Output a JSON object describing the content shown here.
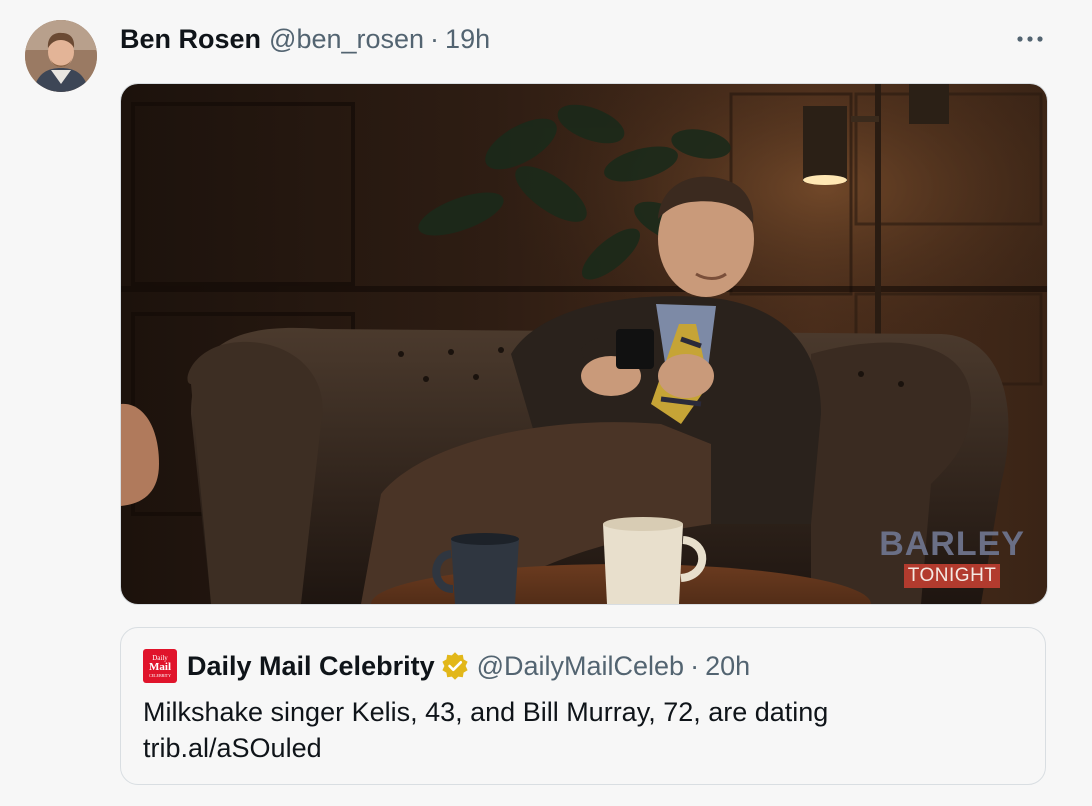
{
  "tweet": {
    "author_name": "Ben Rosen",
    "author_handle": "@ben_rosen",
    "separator": "·",
    "timestamp": "19h",
    "more_icon": "more-horizontal-icon",
    "media": {
      "watermark_top": "BARLEY",
      "watermark_bottom": "TONIGHT"
    }
  },
  "quote": {
    "logo_lines": [
      "Daily",
      "Mail",
      "CELEBRITY"
    ],
    "logo_color": "#e0142b",
    "author_name": "Daily Mail Celebrity",
    "verified_icon": "gold-verified-badge-icon",
    "verified_color": "#e2b719",
    "author_handle": "@DailyMailCeleb",
    "separator": "·",
    "timestamp": "20h",
    "text_line1": "Milkshake singer Kelis, 43, and Bill Murray, 72, are dating",
    "text_line2": "trib.al/aSOuled"
  },
  "colors": {
    "background": "#f7f7f7",
    "primary_text": "#0f1419",
    "secondary_text": "#536471"
  }
}
